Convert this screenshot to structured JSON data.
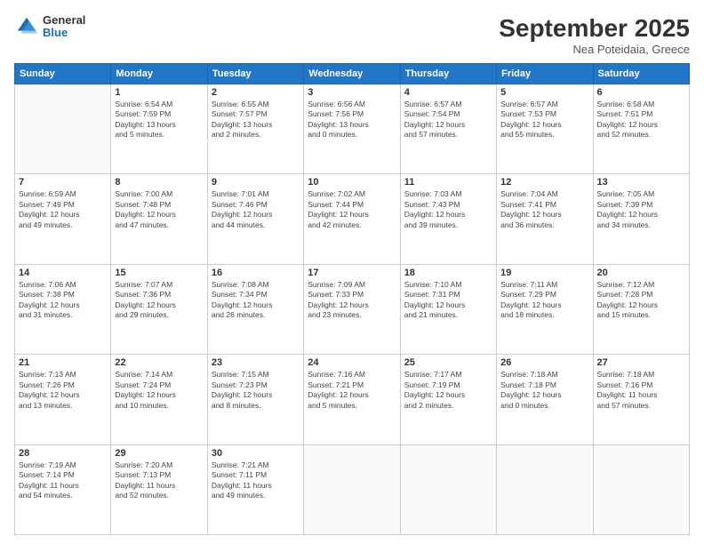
{
  "logo": {
    "general": "General",
    "blue": "Blue"
  },
  "header": {
    "month": "September 2025",
    "location": "Nea Poteidaia, Greece"
  },
  "days_of_week": [
    "Sunday",
    "Monday",
    "Tuesday",
    "Wednesday",
    "Thursday",
    "Friday",
    "Saturday"
  ],
  "weeks": [
    [
      {
        "day": "",
        "info": ""
      },
      {
        "day": "1",
        "info": "Sunrise: 6:54 AM\nSunset: 7:59 PM\nDaylight: 13 hours\nand 5 minutes."
      },
      {
        "day": "2",
        "info": "Sunrise: 6:55 AM\nSunset: 7:57 PM\nDaylight: 13 hours\nand 2 minutes."
      },
      {
        "day": "3",
        "info": "Sunrise: 6:56 AM\nSunset: 7:56 PM\nDaylight: 13 hours\nand 0 minutes."
      },
      {
        "day": "4",
        "info": "Sunrise: 6:57 AM\nSunset: 7:54 PM\nDaylight: 12 hours\nand 57 minutes."
      },
      {
        "day": "5",
        "info": "Sunrise: 6:57 AM\nSunset: 7:53 PM\nDaylight: 12 hours\nand 55 minutes."
      },
      {
        "day": "6",
        "info": "Sunrise: 6:58 AM\nSunset: 7:51 PM\nDaylight: 12 hours\nand 52 minutes."
      }
    ],
    [
      {
        "day": "7",
        "info": "Sunrise: 6:59 AM\nSunset: 7:49 PM\nDaylight: 12 hours\nand 49 minutes."
      },
      {
        "day": "8",
        "info": "Sunrise: 7:00 AM\nSunset: 7:48 PM\nDaylight: 12 hours\nand 47 minutes."
      },
      {
        "day": "9",
        "info": "Sunrise: 7:01 AM\nSunset: 7:46 PM\nDaylight: 12 hours\nand 44 minutes."
      },
      {
        "day": "10",
        "info": "Sunrise: 7:02 AM\nSunset: 7:44 PM\nDaylight: 12 hours\nand 42 minutes."
      },
      {
        "day": "11",
        "info": "Sunrise: 7:03 AM\nSunset: 7:43 PM\nDaylight: 12 hours\nand 39 minutes."
      },
      {
        "day": "12",
        "info": "Sunrise: 7:04 AM\nSunset: 7:41 PM\nDaylight: 12 hours\nand 36 minutes."
      },
      {
        "day": "13",
        "info": "Sunrise: 7:05 AM\nSunset: 7:39 PM\nDaylight: 12 hours\nand 34 minutes."
      }
    ],
    [
      {
        "day": "14",
        "info": "Sunrise: 7:06 AM\nSunset: 7:38 PM\nDaylight: 12 hours\nand 31 minutes."
      },
      {
        "day": "15",
        "info": "Sunrise: 7:07 AM\nSunset: 7:36 PM\nDaylight: 12 hours\nand 29 minutes."
      },
      {
        "day": "16",
        "info": "Sunrise: 7:08 AM\nSunset: 7:34 PM\nDaylight: 12 hours\nand 26 minutes."
      },
      {
        "day": "17",
        "info": "Sunrise: 7:09 AM\nSunset: 7:33 PM\nDaylight: 12 hours\nand 23 minutes."
      },
      {
        "day": "18",
        "info": "Sunrise: 7:10 AM\nSunset: 7:31 PM\nDaylight: 12 hours\nand 21 minutes."
      },
      {
        "day": "19",
        "info": "Sunrise: 7:11 AM\nSunset: 7:29 PM\nDaylight: 12 hours\nand 18 minutes."
      },
      {
        "day": "20",
        "info": "Sunrise: 7:12 AM\nSunset: 7:28 PM\nDaylight: 12 hours\nand 15 minutes."
      }
    ],
    [
      {
        "day": "21",
        "info": "Sunrise: 7:13 AM\nSunset: 7:26 PM\nDaylight: 12 hours\nand 13 minutes."
      },
      {
        "day": "22",
        "info": "Sunrise: 7:14 AM\nSunset: 7:24 PM\nDaylight: 12 hours\nand 10 minutes."
      },
      {
        "day": "23",
        "info": "Sunrise: 7:15 AM\nSunset: 7:23 PM\nDaylight: 12 hours\nand 8 minutes."
      },
      {
        "day": "24",
        "info": "Sunrise: 7:16 AM\nSunset: 7:21 PM\nDaylight: 12 hours\nand 5 minutes."
      },
      {
        "day": "25",
        "info": "Sunrise: 7:17 AM\nSunset: 7:19 PM\nDaylight: 12 hours\nand 2 minutes."
      },
      {
        "day": "26",
        "info": "Sunrise: 7:18 AM\nSunset: 7:18 PM\nDaylight: 12 hours\nand 0 minutes."
      },
      {
        "day": "27",
        "info": "Sunrise: 7:18 AM\nSunset: 7:16 PM\nDaylight: 11 hours\nand 57 minutes."
      }
    ],
    [
      {
        "day": "28",
        "info": "Sunrise: 7:19 AM\nSunset: 7:14 PM\nDaylight: 11 hours\nand 54 minutes."
      },
      {
        "day": "29",
        "info": "Sunrise: 7:20 AM\nSunset: 7:13 PM\nDaylight: 11 hours\nand 52 minutes."
      },
      {
        "day": "30",
        "info": "Sunrise: 7:21 AM\nSunset: 7:11 PM\nDaylight: 11 hours\nand 49 minutes."
      },
      {
        "day": "",
        "info": ""
      },
      {
        "day": "",
        "info": ""
      },
      {
        "day": "",
        "info": ""
      },
      {
        "day": "",
        "info": ""
      }
    ]
  ]
}
